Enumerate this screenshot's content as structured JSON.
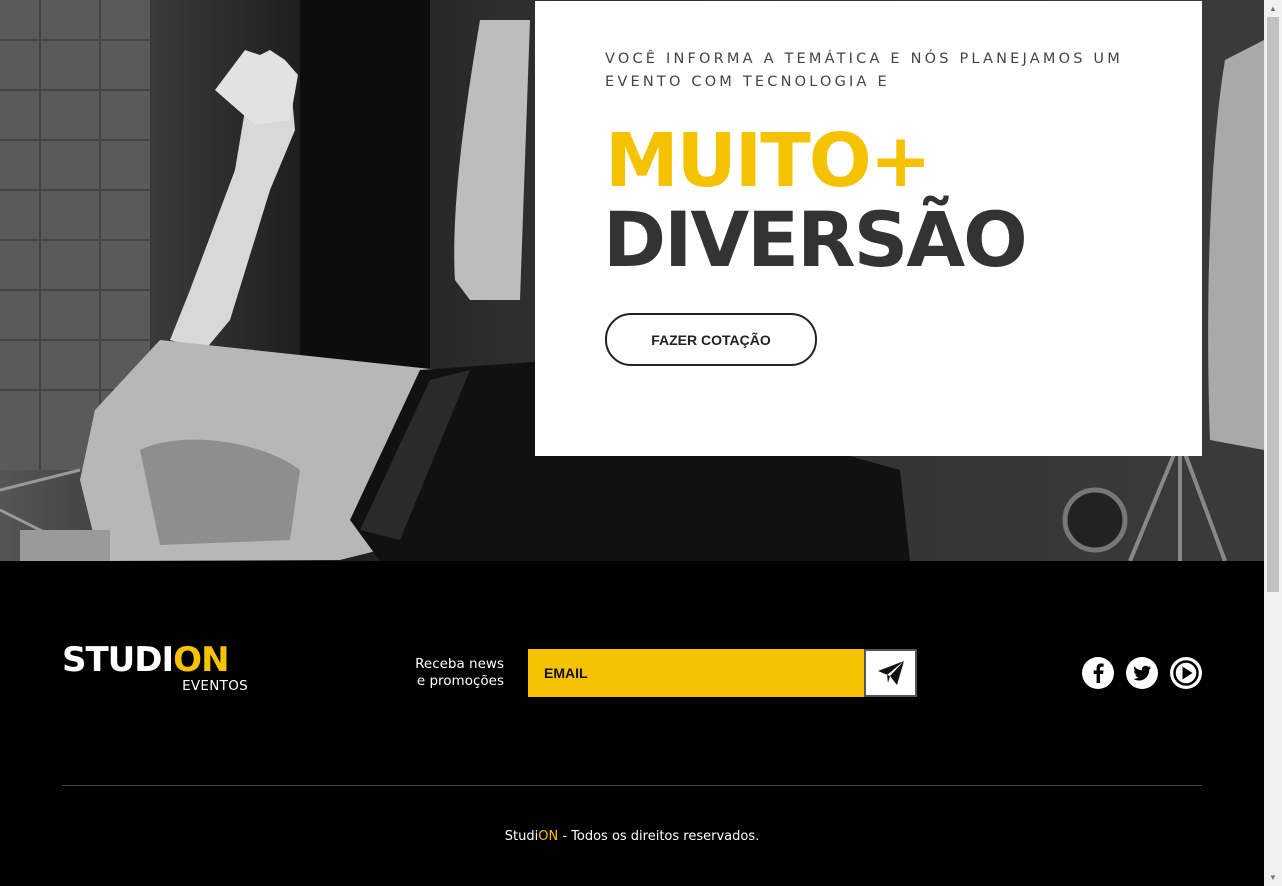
{
  "hero": {
    "tagline": "VOCÊ INFORMA A TEMÁTICA E NÓS PLANEJAMOS UM EVENTO COM TECNOLOGIA E",
    "headline_accent": "MUITO+",
    "headline_main": "DIVERSÃO",
    "cta_label": "FAZER COTAÇÃO"
  },
  "footer": {
    "logo": {
      "main_white": "STUDI",
      "main_accent": "ON",
      "sub": "EVENTOS"
    },
    "newsletter": {
      "label_line1": "Receba news",
      "label_line2": "e promoções",
      "email_placeholder": "EMAIL",
      "send_icon": "paper-plane-icon"
    },
    "social": [
      {
        "name": "facebook",
        "icon": "facebook-icon"
      },
      {
        "name": "twitter",
        "icon": "twitter-icon"
      },
      {
        "name": "youtube",
        "icon": "play-icon"
      }
    ],
    "copyright": {
      "brand_white": "Studi",
      "brand_accent": "ON",
      "text": " - Todos os direitos reservados."
    }
  },
  "colors": {
    "accent": "#f5c200",
    "dark_text": "#333333",
    "footer_bg": "#000000"
  }
}
